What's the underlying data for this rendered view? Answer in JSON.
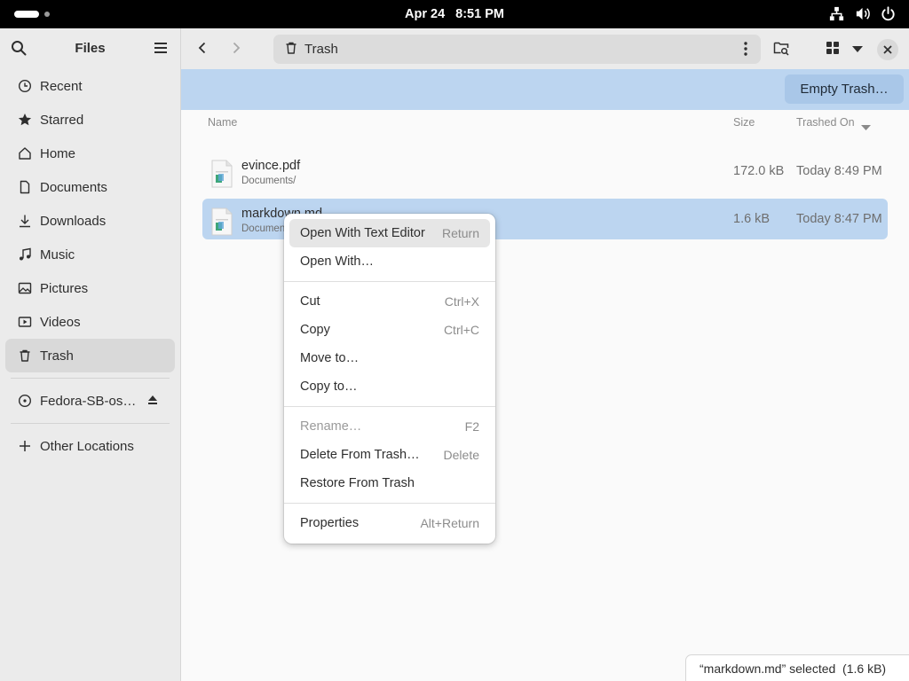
{
  "topbar": {
    "date": "Apr 24",
    "time": "8:51 PM",
    "icons": [
      "network-icon",
      "volume-icon",
      "power-icon"
    ]
  },
  "sidebar": {
    "title": "Files",
    "items": [
      {
        "label": "Recent",
        "icon": "clock-icon"
      },
      {
        "label": "Starred",
        "icon": "star-icon"
      },
      {
        "label": "Home",
        "icon": "home-icon"
      },
      {
        "label": "Documents",
        "icon": "document-icon"
      },
      {
        "label": "Downloads",
        "icon": "download-icon"
      },
      {
        "label": "Music",
        "icon": "music-icon"
      },
      {
        "label": "Pictures",
        "icon": "picture-icon"
      },
      {
        "label": "Videos",
        "icon": "video-icon"
      },
      {
        "label": "Trash",
        "icon": "trash-icon"
      }
    ],
    "volume": {
      "label": "Fedora-SB-os…",
      "icon": "disc-icon"
    },
    "other_locations": "Other Locations"
  },
  "headerbar": {
    "location": "Trash"
  },
  "banner": {
    "empty_trash": "Empty Trash…"
  },
  "columns": {
    "name": "Name",
    "size": "Size",
    "trashed_on": "Trashed On"
  },
  "files": [
    {
      "name": "evince.pdf",
      "path": "Documents/",
      "size": "172.0 kB",
      "trashed": "Today 8:49 PM"
    },
    {
      "name": "markdown.md",
      "path": "Documents/",
      "size": "1.6 kB",
      "trashed": "Today 8:47 PM"
    }
  ],
  "context_menu": {
    "open_text_editor": "Open With Text Editor",
    "open_text_editor_acc": "Return",
    "open_with": "Open With…",
    "cut": "Cut",
    "cut_acc": "Ctrl+X",
    "copy": "Copy",
    "copy_acc": "Ctrl+C",
    "move_to": "Move to…",
    "copy_to": "Copy to…",
    "rename": "Rename…",
    "rename_acc": "F2",
    "delete": "Delete From Trash…",
    "delete_acc": "Delete",
    "restore": "Restore From Trash",
    "properties": "Properties",
    "properties_acc": "Alt+Return"
  },
  "status": "“markdown.md” selected  (1.6 kB)",
  "colors": {
    "selection": "#bcd5f0",
    "sidebar": "#ebebeb",
    "topbar": "#000000"
  }
}
